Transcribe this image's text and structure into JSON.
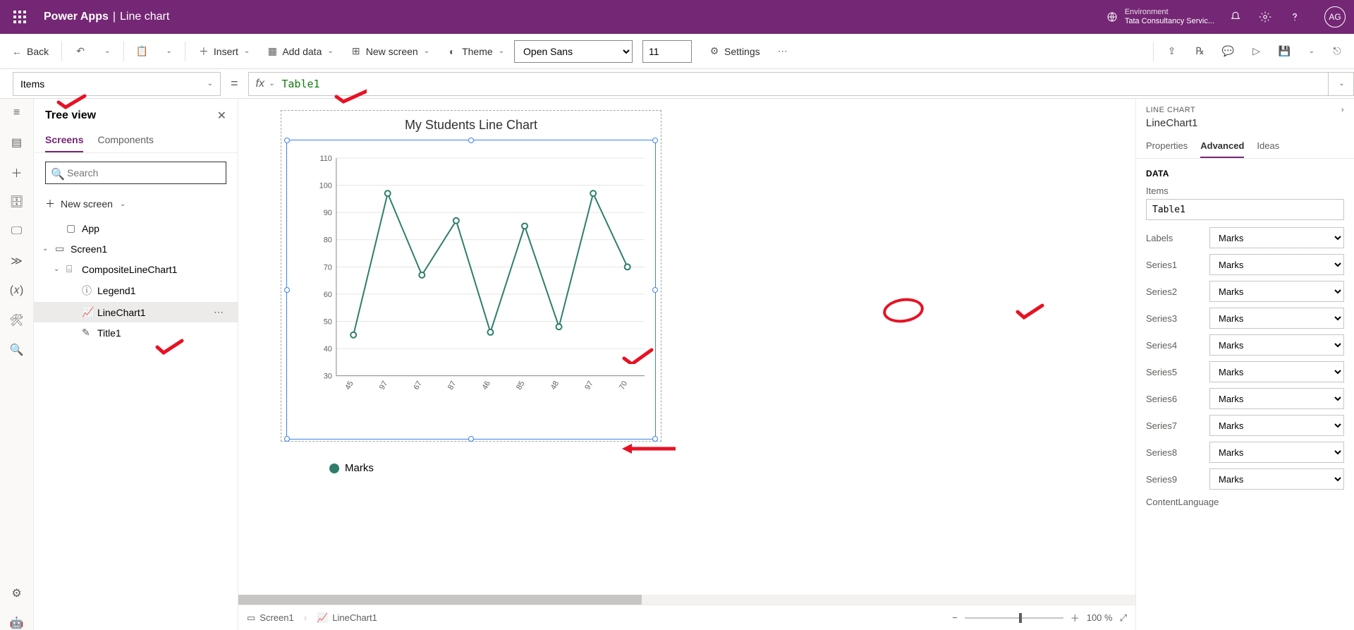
{
  "topbar": {
    "app": "Power Apps",
    "page": "Line chart",
    "env_label": "Environment",
    "env_value": "Tata Consultancy Servic...",
    "avatar": "AG"
  },
  "cmdbar": {
    "back": "Back",
    "insert": "Insert",
    "add_data": "Add data",
    "new_screen": "New screen",
    "theme": "Theme",
    "font": "Open Sans",
    "size": "11",
    "settings": "Settings"
  },
  "fx": {
    "property": "Items",
    "value": "Table1"
  },
  "tree": {
    "title": "Tree view",
    "tab_screens": "Screens",
    "tab_components": "Components",
    "search_ph": "Search",
    "new_screen": "New screen",
    "nodes": {
      "app": "App",
      "screen1": "Screen1",
      "composite": "CompositeLineChart1",
      "legend": "Legend1",
      "linechart": "LineChart1",
      "title": "Title1"
    }
  },
  "chart_data": {
    "type": "line",
    "title": "My Students Line Chart",
    "categories": [
      "45",
      "97",
      "67",
      "87",
      "46",
      "85",
      "48",
      "97",
      "70"
    ],
    "series": [
      {
        "name": "Marks",
        "values": [
          45,
          97,
          67,
          87,
          46,
          85,
          48,
          97,
          70
        ]
      }
    ],
    "ylabel": "",
    "xlabel": "",
    "ylim": [
      30,
      110
    ],
    "yticks": [
      30,
      40,
      50,
      60,
      70,
      80,
      90,
      100,
      110
    ],
    "legend_label": "Marks"
  },
  "status": {
    "crumb1": "Screen1",
    "crumb2": "LineChart1",
    "zoom": "100 %"
  },
  "rpanel": {
    "header": "LINE CHART",
    "name": "LineChart1",
    "tab_props": "Properties",
    "tab_adv": "Advanced",
    "tab_ideas": "Ideas",
    "section_data": "DATA",
    "items_label": "Items",
    "items_value": "Table1",
    "rows": [
      {
        "label": "Labels",
        "value": "Marks"
      },
      {
        "label": "Series1",
        "value": "Marks"
      },
      {
        "label": "Series2",
        "value": "Marks"
      },
      {
        "label": "Series3",
        "value": "Marks"
      },
      {
        "label": "Series4",
        "value": "Marks"
      },
      {
        "label": "Series5",
        "value": "Marks"
      },
      {
        "label": "Series6",
        "value": "Marks"
      },
      {
        "label": "Series7",
        "value": "Marks"
      },
      {
        "label": "Series8",
        "value": "Marks"
      },
      {
        "label": "Series9",
        "value": "Marks"
      }
    ],
    "content_lang": "ContentLanguage"
  }
}
